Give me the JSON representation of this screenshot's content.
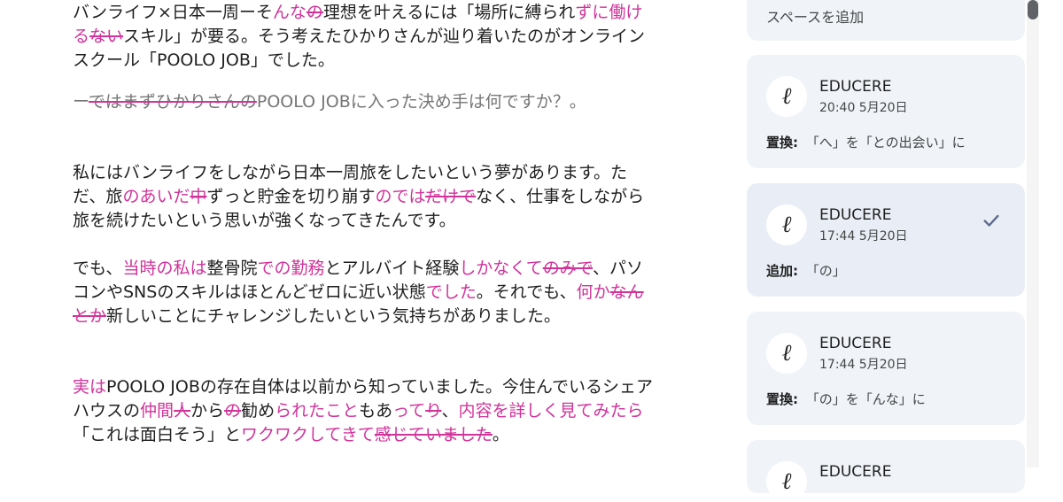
{
  "document": {
    "lead": [
      {
        "t": "バンライフ×日本一周ーそ",
        "k": "n"
      },
      {
        "t": "んな",
        "k": "ins"
      },
      {
        "t": "の",
        "k": "del"
      },
      {
        "t": "理想を叶えるには「場所に縛られ",
        "k": "n"
      },
      {
        "t": "ずに働ける",
        "k": "ins"
      },
      {
        "t": "ない",
        "k": "del"
      },
      {
        "t": "スキル」が要る。そう考えたひかりさんが辿り着いたのがオンラインスクール「POOLO JOB」でした。",
        "k": "n"
      }
    ],
    "question": [
      {
        "t": "ー",
        "k": "n"
      },
      {
        "t": "ではまずひかりさんの",
        "k": "del"
      },
      {
        "t": "POOLO JOBに入った決め手は何ですか？。",
        "k": "n"
      }
    ],
    "para1": [
      {
        "t": "私にはバンライフをしながら日本一周旅をしたいという夢があります。ただ、旅",
        "k": "n"
      },
      {
        "t": "のあいだ",
        "k": "ins"
      },
      {
        "t": "中",
        "k": "del"
      },
      {
        "t": "ずっと貯金を切り崩す",
        "k": "n"
      },
      {
        "t": "のでは",
        "k": "ins"
      },
      {
        "t": "だけで",
        "k": "del"
      },
      {
        "t": "なく、仕事をしながら旅を続けたいという思いが強くなってきたんです。",
        "k": "n"
      }
    ],
    "para2": [
      {
        "t": "でも、",
        "k": "n"
      },
      {
        "t": "当時の私は",
        "k": "ins"
      },
      {
        "t": "整骨院",
        "k": "n"
      },
      {
        "t": "での勤務",
        "k": "ins"
      },
      {
        "t": "とアルバイト経験",
        "k": "n"
      },
      {
        "t": "しかなくて",
        "k": "ins"
      },
      {
        "t": "のみで",
        "k": "del"
      },
      {
        "t": "、パソコンやSNSのスキルはほとんどゼロに近い状態",
        "k": "n"
      },
      {
        "t": "でした",
        "k": "ins"
      },
      {
        "t": "。それでも、",
        "k": "n"
      },
      {
        "t": "何か",
        "k": "ins"
      },
      {
        "t": "なんとか",
        "k": "del"
      },
      {
        "t": "新しいことにチャレンジしたいという気持ちがありました。",
        "k": "n"
      }
    ],
    "para3": [
      {
        "t": "実は",
        "k": "ins"
      },
      {
        "t": "POOLO JOBの存在自体は以前から知っていました。今住んでいるシェアハウスの",
        "k": "n"
      },
      {
        "t": "仲間",
        "k": "ins"
      },
      {
        "t": "人",
        "k": "del"
      },
      {
        "t": "から",
        "k": "n"
      },
      {
        "t": "の",
        "k": "del"
      },
      {
        "t": "勧め",
        "k": "n"
      },
      {
        "t": "られたこと",
        "k": "ins"
      },
      {
        "t": "もあ",
        "k": "n"
      },
      {
        "t": "って",
        "k": "ins"
      },
      {
        "t": "り",
        "k": "del"
      },
      {
        "t": "、",
        "k": "n"
      },
      {
        "t": "内容を詳しく見てみたら",
        "k": "ins"
      },
      {
        "t": "「これは面白そう」と",
        "k": "n"
      },
      {
        "t": "ワクワクしてきて",
        "k": "ins"
      },
      {
        "t": "感じていました",
        "k": "del"
      },
      {
        "t": "。",
        "k": "n"
      }
    ]
  },
  "sidebar": {
    "add_space": "スペースを追加",
    "suggestions": [
      {
        "author": "EDUCERE",
        "time": "20:40 5月20日",
        "type": "置換:",
        "detail": "「へ」を「との出会い」に",
        "avatar": "ℓ"
      },
      {
        "author": "EDUCERE",
        "time": "17:44 5月20日",
        "type": "追加:",
        "detail": "「の」",
        "avatar": "ℓ"
      },
      {
        "author": "EDUCERE",
        "time": "17:44 5月20日",
        "type": "置換:",
        "detail": "「の」を「んな」に",
        "avatar": "ℓ"
      },
      {
        "author": "EDUCERE",
        "avatar": "ℓ"
      }
    ]
  },
  "colors": {
    "suggestion": "#d1339a",
    "accept_check": "#5b6b8c"
  }
}
